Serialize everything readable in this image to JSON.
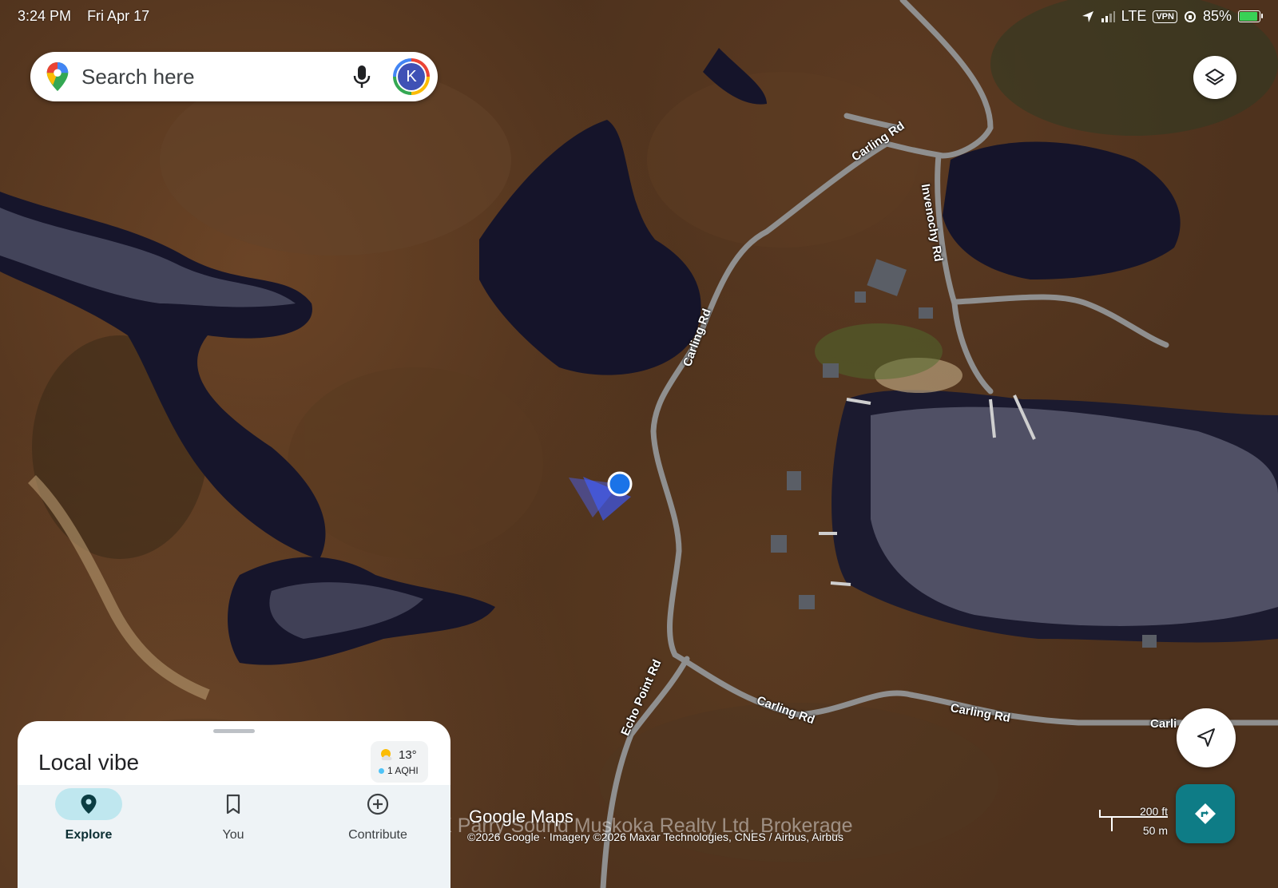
{
  "status_bar": {
    "time": "3:24 PM",
    "date": "Fri Apr 17",
    "network": "LTE",
    "vpn": "VPN",
    "battery": "85%",
    "battery_level": 0.85
  },
  "search": {
    "placeholder": "Search here",
    "avatar_letter": "K"
  },
  "map": {
    "road_labels": [
      "Carling Rd",
      "Carling Rd",
      "Invenochy Rd",
      "Echo Point Rd",
      "Carling Rd",
      "Carling Rd",
      "Carli"
    ],
    "google_logo": "Google Maps",
    "attribution": "©2026 Google · Imagery ©2026 Maxar Technologies, CNES / Airbus, Airbus",
    "watermark": "RE/MAX Parry Sound Muskoka Realty Ltd. Brokerage",
    "scale_ft": "200 ft",
    "scale_m": "50 m"
  },
  "sheet": {
    "title": "Local vibe",
    "weather_temp": "13°",
    "air_quality": "1 AQHI"
  },
  "nav": {
    "items": [
      {
        "label": "Explore",
        "icon": "place-pin-icon",
        "active": true
      },
      {
        "label": "You",
        "icon": "bookmark-icon",
        "active": false
      },
      {
        "label": "Contribute",
        "icon": "add-circle-icon",
        "active": false
      }
    ]
  },
  "colors": {
    "accent": "#0e7c86",
    "location_dot": "#1a73e8",
    "water": "#14142a",
    "land": "#4e321d",
    "road": "#8f8f8f"
  }
}
